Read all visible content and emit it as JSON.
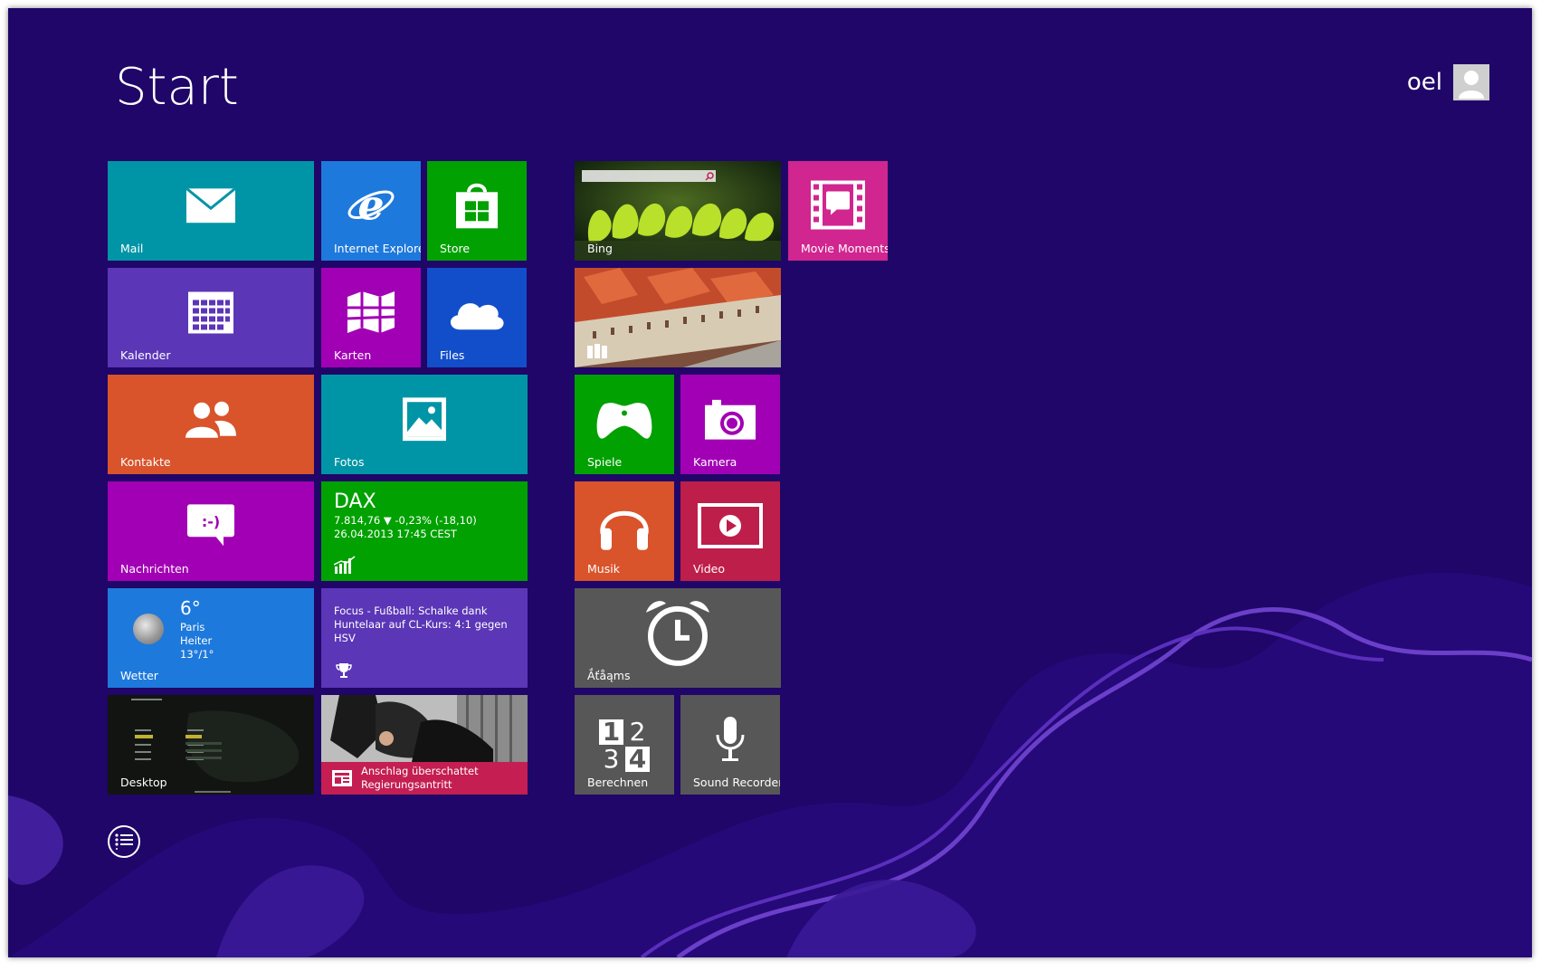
{
  "header": {
    "title": "Start",
    "user_name": "oel"
  },
  "colors": {
    "background": "#1f0668",
    "teal": "#0095a6",
    "blue": "#1e79dc",
    "green": "#00a100",
    "purple": "#5b36b7",
    "magenta": "#a200b4",
    "orange": "#d9532b",
    "pink": "#d1258f",
    "crimson": "#be1e4a",
    "gray": "#575757",
    "darkblue": "#124ec9"
  },
  "tiles": {
    "mail": {
      "label": "Mail",
      "icon": "mail-icon"
    },
    "ie": {
      "label": "Internet Explorer",
      "icon": "internet-explorer-icon"
    },
    "store": {
      "label": "Store",
      "icon": "store-bag-icon"
    },
    "kalender": {
      "label": "Kalender",
      "icon": "calendar-icon"
    },
    "karten": {
      "label": "Karten",
      "icon": "map-icon"
    },
    "files": {
      "label": "Files",
      "icon": "cloud-icon"
    },
    "kontakte": {
      "label": "Kontakte",
      "icon": "people-icon"
    },
    "fotos": {
      "label": "Fotos",
      "icon": "photo-icon"
    },
    "nachrichten": {
      "label": "Nachrichten",
      "icon": "chat-bubble-icon",
      "emoticon": ":-)"
    },
    "dax": {
      "name": "DAX",
      "value_line": "7.814,76  ▼ -0,23% (-18,10)",
      "date_line": "26.04.2013 17:45 CEST",
      "icon": "finance-chart-icon"
    },
    "wetter": {
      "label": "Wetter",
      "temp": "6°",
      "city": "Paris",
      "condition": "Heiter",
      "range": "13°/1°",
      "icon": "moon-icon"
    },
    "sport": {
      "headline": "Focus - Fußball: Schalke dank Huntelaar auf CL-Kurs: 4:1 gegen HSV",
      "icon": "trophy-icon"
    },
    "desktop": {
      "label": "Desktop"
    },
    "news": {
      "headline": "Anschlag überschattet Regierungsantritt",
      "icon": "newspaper-icon"
    },
    "bing": {
      "label": "Bing",
      "icon": "search-icon"
    },
    "movie": {
      "label": "Movie Moments",
      "icon": "film-strip-icon"
    },
    "photo_live": {
      "icon": "photo-stack-icon"
    },
    "spiele": {
      "label": "Spiele",
      "icon": "game-controller-icon"
    },
    "kamera": {
      "label": "Kamera",
      "icon": "camera-icon"
    },
    "musik": {
      "label": "Musik",
      "icon": "headphones-icon"
    },
    "video": {
      "label": "Video",
      "icon": "video-play-icon"
    },
    "alarms": {
      "label": "Ắťåąms",
      "icon": "alarm-clock-icon"
    },
    "berechnen": {
      "label": "Berechnen",
      "icon": "calculator-icon",
      "digits": [
        "1",
        "2",
        "3",
        "4"
      ]
    },
    "sound": {
      "label": "Sound Recorder",
      "icon": "microphone-icon"
    }
  },
  "apps_button": {
    "icon": "all-apps-icon"
  }
}
